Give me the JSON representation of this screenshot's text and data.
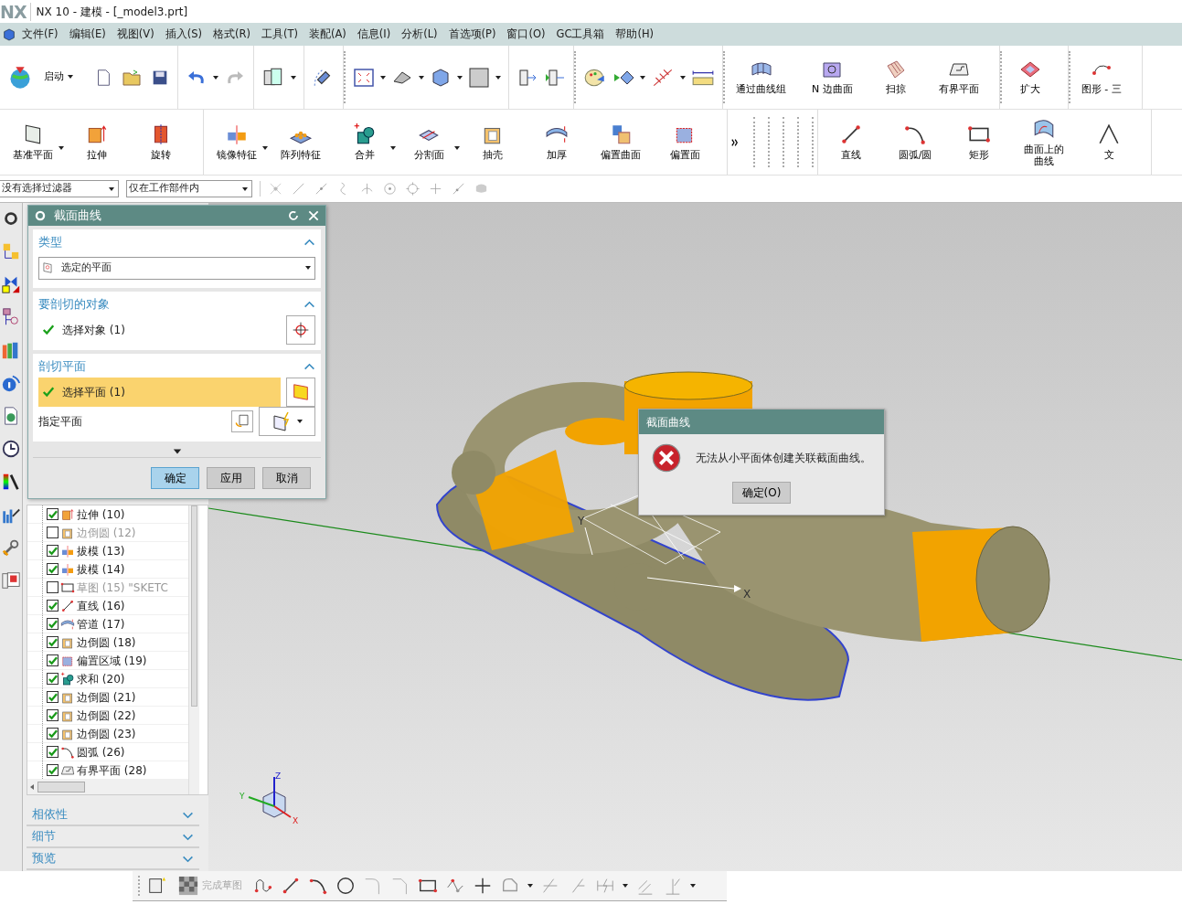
{
  "window": {
    "logo": "NX",
    "title": "NX 10 - 建模 - [_model3.prt]"
  },
  "menu": [
    "文件(F)",
    "编辑(E)",
    "视图(V)",
    "插入(S)",
    "格式(R)",
    "工具(T)",
    "装配(A)",
    "信息(I)",
    "分析(L)",
    "首选项(P)",
    "窗口(O)",
    "GC工具箱",
    "帮助(H)"
  ],
  "toolbar_row1": {
    "start": "启动",
    "groups": [
      [
        "通过曲线组",
        "N 边曲面",
        "扫掠",
        "有界平面"
      ],
      [
        "扩大"
      ],
      [
        "图形 - 三"
      ]
    ]
  },
  "toolbar_row2": {
    "groups": [
      [
        {
          "label": "基准平面",
          "dropdown": true
        },
        {
          "label": "拉伸",
          "dropdown": false
        },
        {
          "label": "旋转",
          "dropdown": false
        }
      ],
      [
        {
          "label": "镜像特征",
          "dropdown": true
        },
        {
          "label": "阵列特征",
          "dropdown": false
        },
        {
          "label": "合并",
          "dropdown": true
        },
        {
          "label": "分割面",
          "dropdown": true
        },
        {
          "label": "抽壳",
          "dropdown": false
        },
        {
          "label": "加厚",
          "dropdown": false
        },
        {
          "label": "偏置曲面",
          "dropdown": false
        },
        {
          "label": "偏置面",
          "dropdown": false
        }
      ],
      [
        {
          "label": "直线",
          "dropdown": false
        },
        {
          "label": "圆弧/圆",
          "dropdown": false
        },
        {
          "label": "矩形",
          "dropdown": false
        },
        {
          "label": "曲面上的曲线",
          "dropdown": false
        },
        {
          "label": "文",
          "dropdown": false
        }
      ]
    ]
  },
  "selection_bar": {
    "filter": "没有选择过滤器",
    "scope": "仅在工作部件内"
  },
  "dialog": {
    "title": "截面曲线",
    "sections": [
      {
        "title": "类型",
        "expanded": true,
        "items": [
          {
            "kind": "select",
            "value": "选定的平面"
          }
        ]
      },
      {
        "title": "要剖切的对象",
        "expanded": true,
        "items": [
          {
            "kind": "selection",
            "label": "选择对象 (1)",
            "complete": true,
            "selected": false
          }
        ]
      },
      {
        "title": "剖切平面",
        "expanded": true,
        "items": [
          {
            "kind": "selection",
            "label": "选择平面 (1)",
            "complete": true,
            "selected": true
          },
          {
            "kind": "plane",
            "label": "指定平面"
          }
        ]
      }
    ],
    "buttons": [
      {
        "label": "确定",
        "default": true
      },
      {
        "label": "应用",
        "default": false
      },
      {
        "label": "取消",
        "default": false
      }
    ]
  },
  "tree": {
    "rows": [
      {
        "label": "拉伸 (10)",
        "checked": true,
        "suppressed": false,
        "kind": "extrude"
      },
      {
        "label": "边倒圆 (12)",
        "checked": false,
        "suppressed": true,
        "kind": "blend"
      },
      {
        "label": "拔模 (13)",
        "checked": true,
        "suppressed": false,
        "kind": "draft"
      },
      {
        "label": "拔模 (14)",
        "checked": true,
        "suppressed": false,
        "kind": "draft"
      },
      {
        "label": "草图 (15) \"SKETC",
        "checked": false,
        "suppressed": true,
        "kind": "sketch"
      },
      {
        "label": "直线 (16)",
        "checked": true,
        "suppressed": false,
        "kind": "line"
      },
      {
        "label": "管道 (17)",
        "checked": true,
        "suppressed": false,
        "kind": "tube"
      },
      {
        "label": "边倒圆 (18)",
        "checked": true,
        "suppressed": false,
        "kind": "blend"
      },
      {
        "label": "偏置区域 (19)",
        "checked": true,
        "suppressed": false,
        "kind": "offset"
      },
      {
        "label": "求和 (20)",
        "checked": true,
        "suppressed": false,
        "kind": "unite"
      },
      {
        "label": "边倒圆 (21)",
        "checked": true,
        "suppressed": false,
        "kind": "blend"
      },
      {
        "label": "边倒圆 (22)",
        "checked": true,
        "suppressed": false,
        "kind": "blend"
      },
      {
        "label": "边倒圆 (23)",
        "checked": true,
        "suppressed": false,
        "kind": "blend"
      },
      {
        "label": "圆弧 (26)",
        "checked": true,
        "suppressed": false,
        "kind": "arc"
      },
      {
        "label": "有界平面 (28)",
        "checked": true,
        "suppressed": false,
        "kind": "plane"
      }
    ],
    "panels": [
      {
        "title": "相依性",
        "expanded": false
      },
      {
        "title": "细节",
        "expanded": false
      },
      {
        "title": "预览",
        "expanded": false
      }
    ]
  },
  "viewport": {
    "model_axes": [
      "Y",
      "X"
    ],
    "triad_axes": [
      "Z",
      "Y",
      "X"
    ]
  },
  "error_dialog": {
    "title": "截面曲线",
    "message": "无法从小平面体创建关联截面曲线。",
    "button": "确定(O)"
  },
  "sketch_toolbar": {
    "finish": {
      "label": "完成草图",
      "disabled": true
    }
  }
}
